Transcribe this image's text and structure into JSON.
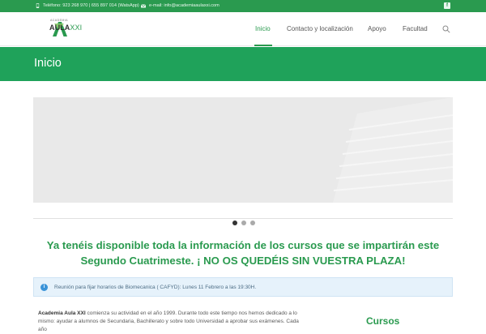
{
  "topbar": {
    "phone": "Teléfono: 923 268 970  |  655 897 014 (WatsApp)",
    "email": "e-mail: info@academiaaulaxxi.com",
    "facebook_icon": "facebook-icon",
    "phone_icon": "phone-icon",
    "mail_icon": "mail-icon"
  },
  "header": {
    "logo_small": "ACADEMIA",
    "logo_main": "AULA",
    "logo_suffix": "XXI",
    "nav": [
      {
        "label": "Inicio"
      },
      {
        "label": "Contacto y localización"
      },
      {
        "label": "Apoyo"
      },
      {
        "label": "Facultad"
      }
    ],
    "search_icon": "search-icon"
  },
  "hero": {
    "title": "Inicio"
  },
  "slider": {
    "active_slide": 1,
    "slide_count": 3
  },
  "headline": {
    "line1": "Ya tenéis disponible toda la información de los cursos que se impartirán este",
    "line2": "Segundo Cuatrimeste. ¡ NO OS QUEDÉIS SIN VUESTRA PLAZA!"
  },
  "notice": {
    "text": "Reunión para fijar horarios de Biomecanica ( CAFYD): Lunes 11 Febrero a  las 19:30H."
  },
  "content": {
    "para_bold": "Academia Aula XXI",
    "para_rest": " comienza su actividad en el año 1999. Durante todo este tiempo nos hemos dedicado a lo mismo: ayudar a alumnos de Secundaria, Bachillerato y sobre todo Universidad a aprobar sus exámenes. Cada año",
    "side_title": "Cursos"
  },
  "colors": {
    "brand": "#2a9a4f",
    "hero": "#1fa25a",
    "info": "#3b93d8"
  }
}
